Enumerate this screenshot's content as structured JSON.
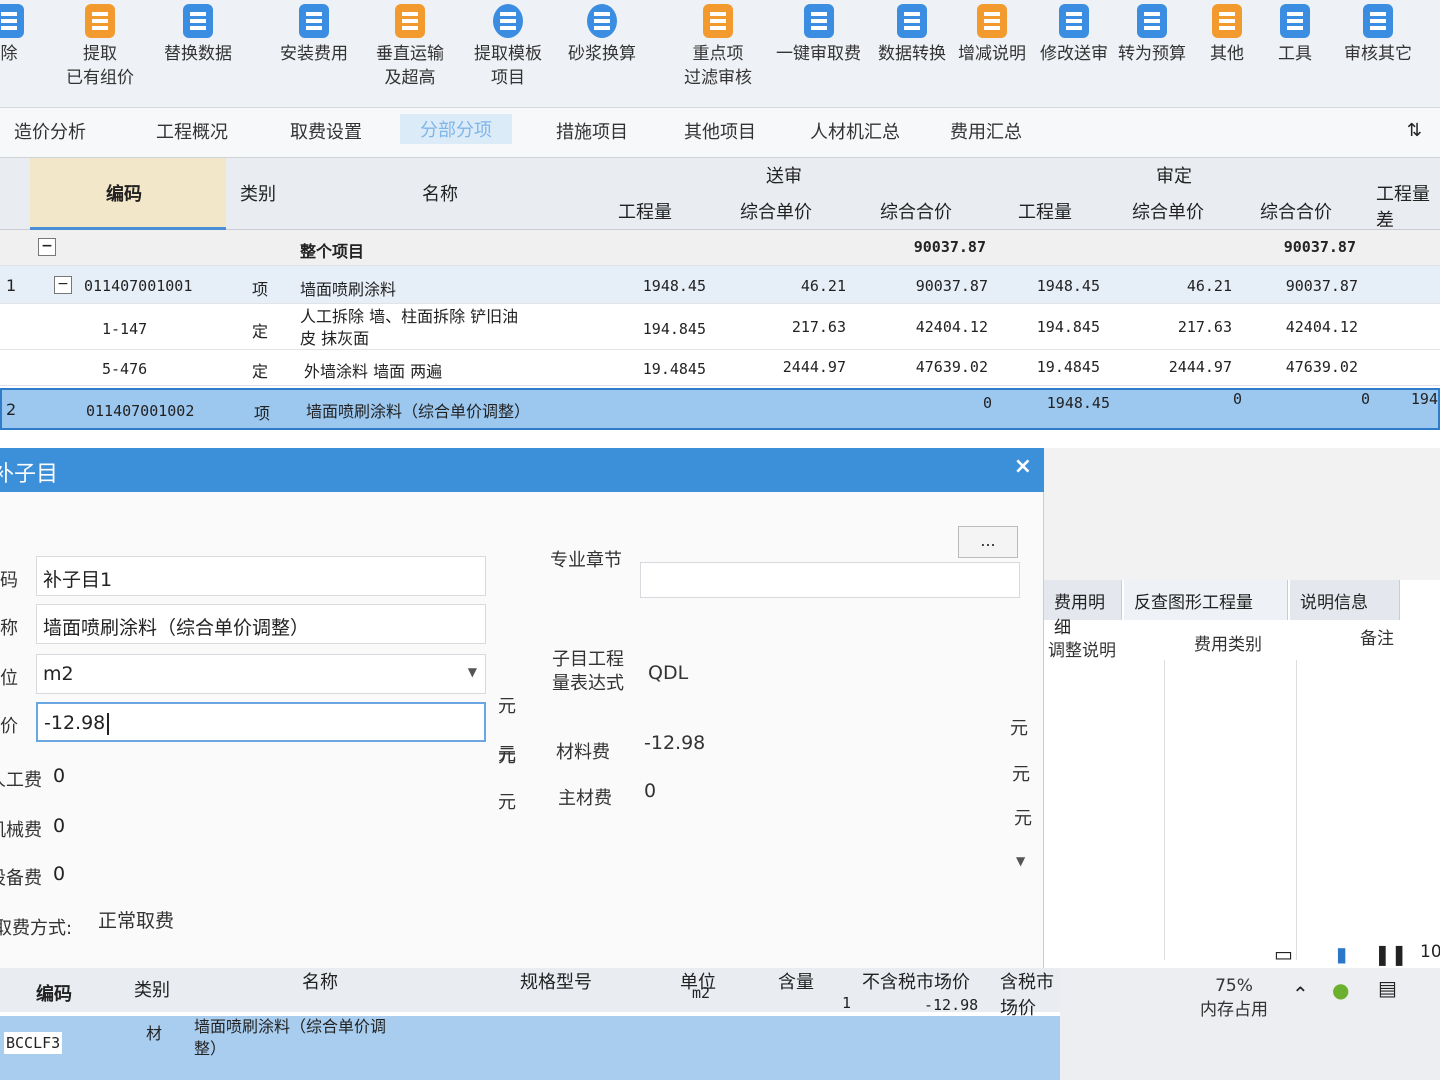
{
  "ribbon": [
    {
      "label": "除",
      "icon": "delete-icon"
    },
    {
      "label": "提取\n已有组价",
      "icon": "extract-price-icon"
    },
    {
      "label": "替换数据",
      "icon": "replace-data-icon"
    },
    {
      "label": "安装费用",
      "icon": "install-fee-icon"
    },
    {
      "label": "垂直运输\n及超高",
      "icon": "vertical-transport-icon"
    },
    {
      "label": "提取模板\n项目",
      "icon": "template-icon"
    },
    {
      "label": "砂浆换算",
      "icon": "mortar-convert-icon"
    },
    {
      "label": "重点项\n过滤审核",
      "icon": "filter-audit-icon"
    },
    {
      "label": "一键审取费",
      "icon": "audit-fee-icon"
    },
    {
      "label": "数据转换",
      "icon": "data-convert-icon"
    },
    {
      "label": "增减说明",
      "icon": "change-note-icon"
    },
    {
      "label": "修改送审",
      "icon": "edit-submit-icon"
    },
    {
      "label": "转为预算",
      "icon": "to-budget-icon"
    },
    {
      "label": "其他",
      "icon": "other-icon"
    },
    {
      "label": "工具",
      "icon": "tools-icon"
    },
    {
      "label": "审核其它",
      "icon": "audit-other-icon"
    }
  ],
  "tabs": [
    "造价分析",
    "工程概况",
    "取费设置",
    "分部分项",
    "措施项目",
    "其他项目",
    "人材机汇总",
    "费用汇总"
  ],
  "tab_tool": "⇅",
  "grid": {
    "headers": {
      "code": "编码",
      "type": "类别",
      "name": "名称",
      "group_submit": "送审",
      "group_audit": "审定",
      "qty": "工程量",
      "unit_price": "综合单价",
      "total": "综合合价",
      "diff": "工程量差"
    },
    "rows": [
      {
        "no": "",
        "code": "",
        "type": "",
        "name": "整个项目",
        "s_qty": "",
        "s_up": "",
        "s_tot": "90037.87",
        "a_qty": "",
        "a_up": "",
        "a_tot": "90037.87"
      },
      {
        "no": "1",
        "code": "011407001001",
        "type": "项",
        "name": "墙面喷刷涂料",
        "s_qty": "1948.45",
        "s_up": "46.21",
        "s_tot": "90037.87",
        "a_qty": "1948.45",
        "a_up": "46.21",
        "a_tot": "90037.87"
      },
      {
        "no": "",
        "code": "1-147",
        "type": "定",
        "name": "人工拆除 墙、柱面拆除 铲旧油\n皮 抹灰面",
        "s_qty": "194.845",
        "s_up": "217.63",
        "s_tot": "42404.12",
        "a_qty": "194.845",
        "a_up": "217.63",
        "a_tot": "42404.12"
      },
      {
        "no": "",
        "code": "5-476",
        "type": "定",
        "name": "外墙涂料 墙面 两遍",
        "s_qty": "19.4845",
        "s_up": "2444.97",
        "s_tot": "47639.02",
        "a_qty": "19.4845",
        "a_up": "2444.97",
        "a_tot": "47639.02"
      },
      {
        "no": "2",
        "code": "011407001002",
        "type": "项",
        "name": "墙面喷刷涂料（综合单价调整）",
        "s_qty": "",
        "s_up": "",
        "s_tot": "0",
        "a_qty": "1948.45",
        "a_up": "0",
        "a_tot": "0",
        "diff": "194"
      }
    ]
  },
  "dialog": {
    "title": "补子目",
    "close": "×",
    "code_label": "编码",
    "code_value": "补子目1",
    "name_label": "名称",
    "name_value": "墙面喷刷涂料（综合单价调整）",
    "unit_label": "单位",
    "unit_value": "m2",
    "price_label": "单价",
    "price_value": "-12.98",
    "labor_label": "人工费",
    "labor_value": "0",
    "machine_label": "机械费",
    "machine_value": "0",
    "equip_label": "设备费",
    "equip_value": "0",
    "fee_mode_label": "取费方式:",
    "fee_mode_value": "正常取费",
    "chapter_label": "专业章节",
    "chapter_button": "...",
    "qty_expr_label": "子目工程\n量表达式",
    "qty_expr_value": "QDL",
    "material_label": "材料费",
    "material_value": "-12.98",
    "main_material_label": "主材费",
    "main_material_value": "0",
    "unit_yuan": "元"
  },
  "right_panel": {
    "tabs": [
      "费用明细",
      "反查图形工程量",
      "说明信息"
    ],
    "headers": [
      "调整说明",
      "费用类别",
      "备注"
    ]
  },
  "sub_table": {
    "headers": [
      "编码",
      "类别",
      "名称",
      "规格型号",
      "单位",
      "含量",
      "不含税市场价",
      "含税市场价"
    ],
    "row": {
      "code": "BCCLF3",
      "type": "材",
      "name": "墙面喷刷涂料（综合单价调\n整）",
      "unit": "m2",
      "qty": "1",
      "price": "-12.98"
    }
  },
  "taskbar": {
    "mem_percent": "75%",
    "mem_label": "内存占用",
    "extra": "10"
  },
  "colors": {
    "accent": "#3c8fd9",
    "selected_row": "#9cc7ef",
    "header_code": "#f3e7c9"
  }
}
